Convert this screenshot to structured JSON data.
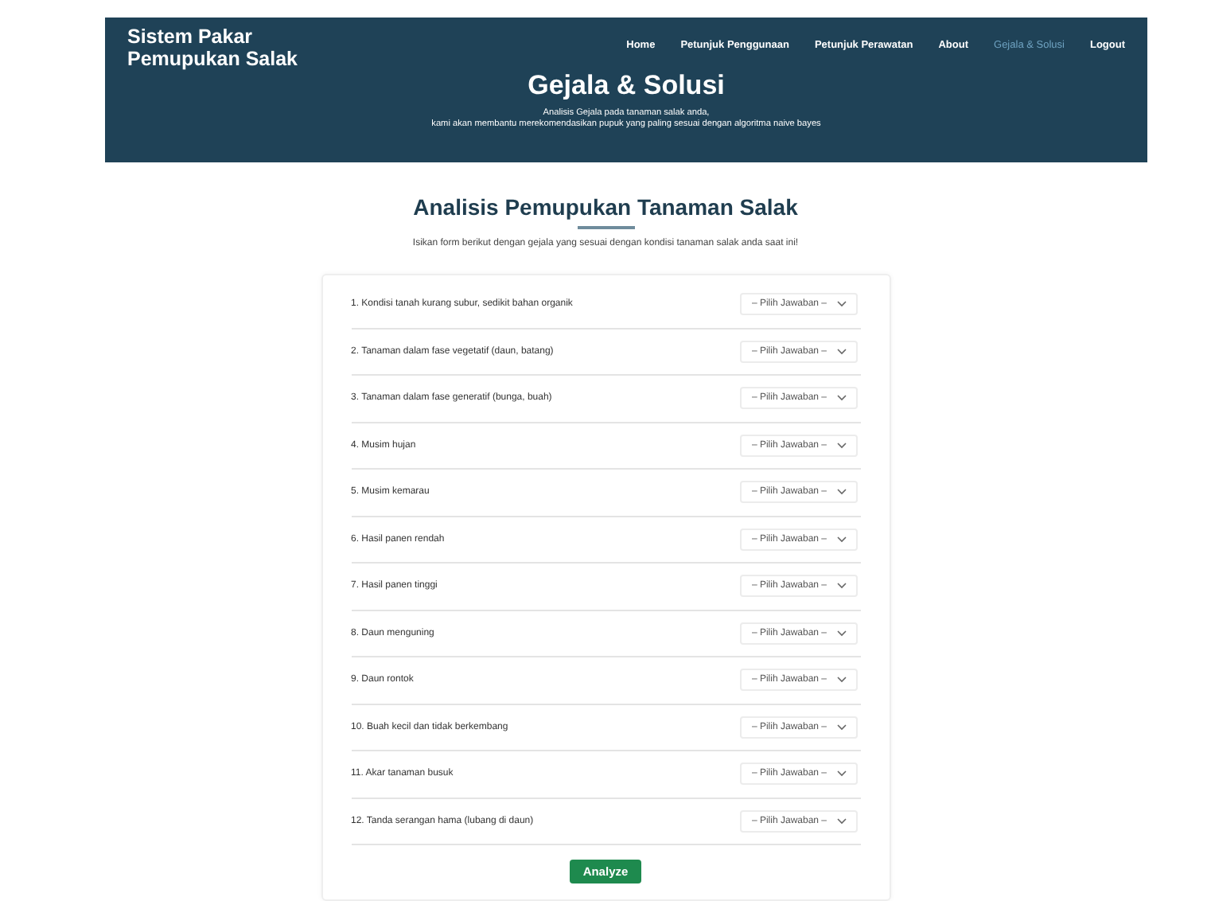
{
  "brand": "Sistem Pakar Pemupukan Salak",
  "nav": [
    {
      "label": "Home",
      "selected": false
    },
    {
      "label": "Petunjuk Penggunaan",
      "selected": false
    },
    {
      "label": "Petunjuk Perawatan",
      "selected": false
    },
    {
      "label": "About",
      "selected": false
    },
    {
      "label": "Gejala & Solusi",
      "selected": true
    },
    {
      "label": "Logout",
      "selected": false
    }
  ],
  "hero": {
    "title": "Gejala & Solusi",
    "lines": [
      "Analisis Gejala pada tanaman salak anda,",
      "kami akan membantu merekomendasikan pupuk yang paling sesuai dengan algoritma naive bayes"
    ]
  },
  "section": {
    "title": "Analisis Pemupukan Tanaman Salak",
    "subtitle": "Isikan form berikut dengan gejala yang sesuai dengan kondisi tanaman salak anda saat ini!"
  },
  "questions": [
    {
      "label": "1. Kondisi tanah kurang subur, sedikit bahan organik",
      "placeholder": "– Pilih Jawaban –"
    },
    {
      "label": "2. Tanaman dalam fase vegetatif (daun, batang)",
      "placeholder": "– Pilih Jawaban –"
    },
    {
      "label": "3. Tanaman dalam fase generatif (bunga, buah)",
      "placeholder": "– Pilih Jawaban –"
    },
    {
      "label": "4. Musim hujan",
      "placeholder": "– Pilih Jawaban –"
    },
    {
      "label": "5. Musim kemarau",
      "placeholder": "– Pilih Jawaban –"
    },
    {
      "label": "6. Hasil panen rendah",
      "placeholder": "– Pilih Jawaban –"
    },
    {
      "label": "7. Hasil panen tinggi",
      "placeholder": "– Pilih Jawaban –"
    },
    {
      "label": "8. Daun menguning",
      "placeholder": "– Pilih Jawaban –"
    },
    {
      "label": "9. Daun rontok",
      "placeholder": "– Pilih Jawaban –"
    },
    {
      "label": "10. Buah kecil dan tidak berkembang",
      "placeholder": "– Pilih Jawaban –"
    },
    {
      "label": "11. Akar tanaman busuk",
      "placeholder": "– Pilih Jawaban –"
    },
    {
      "label": "12. Tanda serangan hama (lubang di daun)",
      "placeholder": "– Pilih Jawaban –"
    }
  ],
  "submit": "Analyze"
}
